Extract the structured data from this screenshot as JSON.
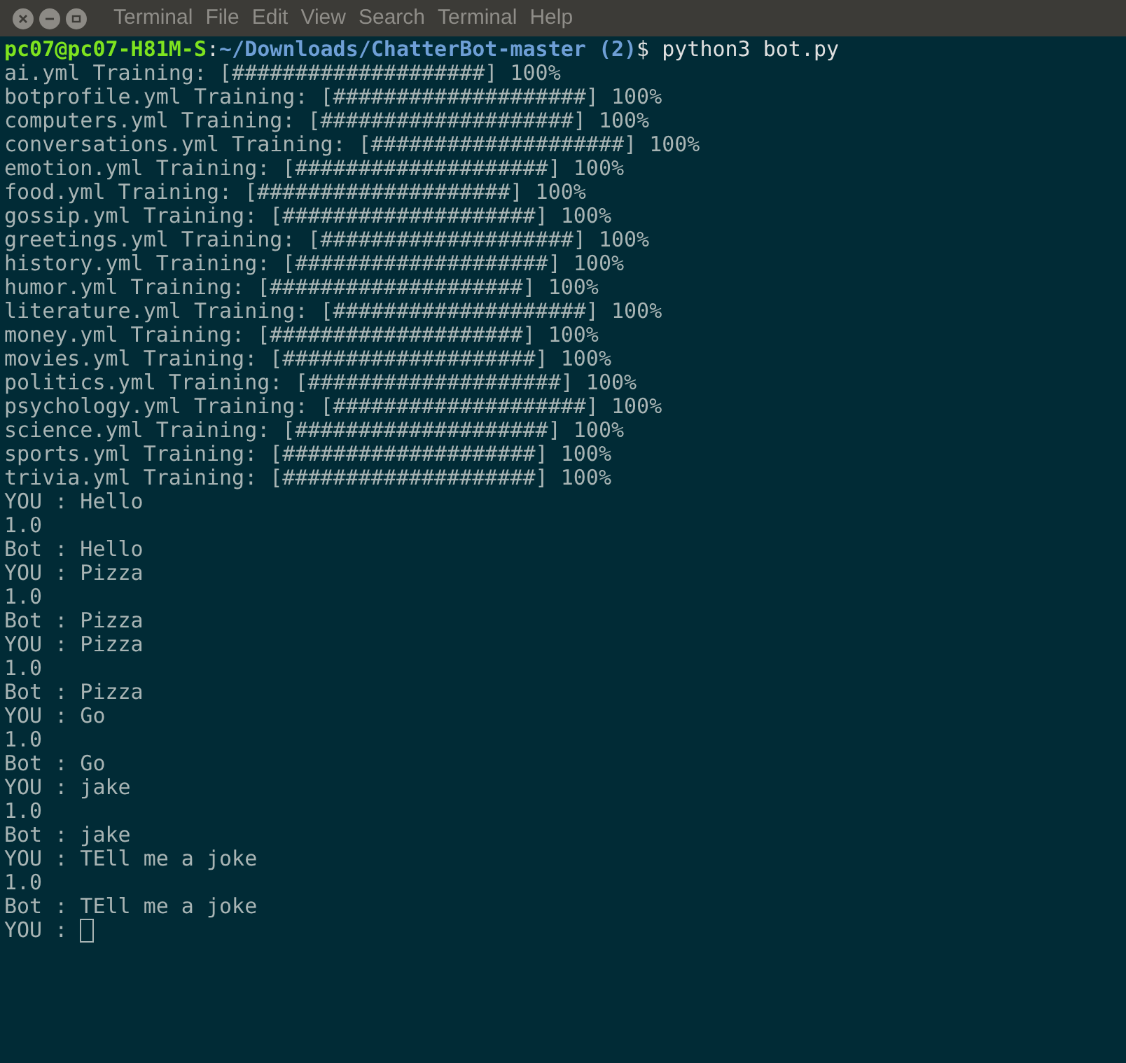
{
  "menu": [
    "Terminal",
    "File",
    "Edit",
    "View",
    "Search",
    "Terminal",
    "Help"
  ],
  "prompt": {
    "user_host": "pc07@pc07-H81M-S",
    "separator": ":",
    "path": "~/Downloads/ChatterBot-master (2)",
    "command": "$ python3 bot.py"
  },
  "output": [
    "ai.yml Training: [####################] 100%",
    "botprofile.yml Training: [####################] 100%",
    "computers.yml Training: [####################] 100%",
    "conversations.yml Training: [####################] 100%",
    "emotion.yml Training: [####################] 100%",
    "food.yml Training: [####################] 100%",
    "gossip.yml Training: [####################] 100%",
    "greetings.yml Training: [####################] 100%",
    "history.yml Training: [####################] 100%",
    "humor.yml Training: [####################] 100%",
    "literature.yml Training: [####################] 100%",
    "money.yml Training: [####################] 100%",
    "movies.yml Training: [####################] 100%",
    "politics.yml Training: [####################] 100%",
    "psychology.yml Training: [####################] 100%",
    "science.yml Training: [####################] 100%",
    "sports.yml Training: [####################] 100%",
    "trivia.yml Training: [####################] 100%",
    "YOU : Hello",
    "1.0",
    "Bot : Hello",
    "YOU : Pizza",
    "1.0",
    "Bot : Pizza",
    "YOU : Pizza",
    "1.0",
    "Bot : Pizza",
    "YOU : Go",
    "1.0",
    "Bot : Go",
    "YOU : jake",
    "1.0",
    "Bot : jake",
    "YOU : TEll me a joke",
    "1.0",
    "Bot : TEll me a joke"
  ],
  "input_line": {
    "prompt": "YOU :",
    "cursor": true
  }
}
